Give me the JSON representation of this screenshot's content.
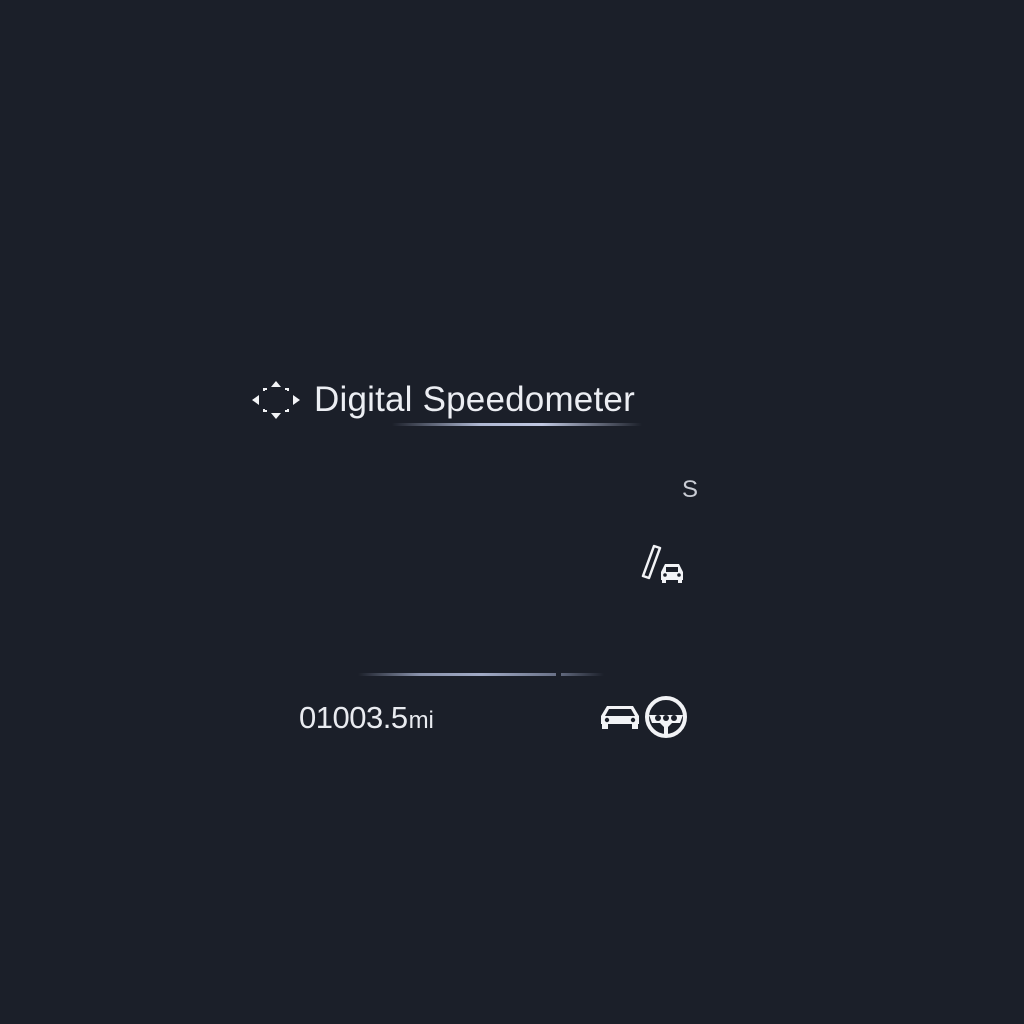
{
  "header": {
    "icon": "dpad-arrows-icon",
    "title": "Digital Speedometer"
  },
  "status": {
    "gear": "S",
    "lane_assist_icon": "lane-departure-icon"
  },
  "odometer": {
    "value": "01003.5",
    "unit": "mi"
  },
  "indicators": {
    "vehicle_icon": "car-icon",
    "steering_icon": "steering-wheel-icon"
  },
  "colors": {
    "background": "#1b1f29",
    "text": "#e9ebf0",
    "accent_line": "#c8d0ee"
  }
}
